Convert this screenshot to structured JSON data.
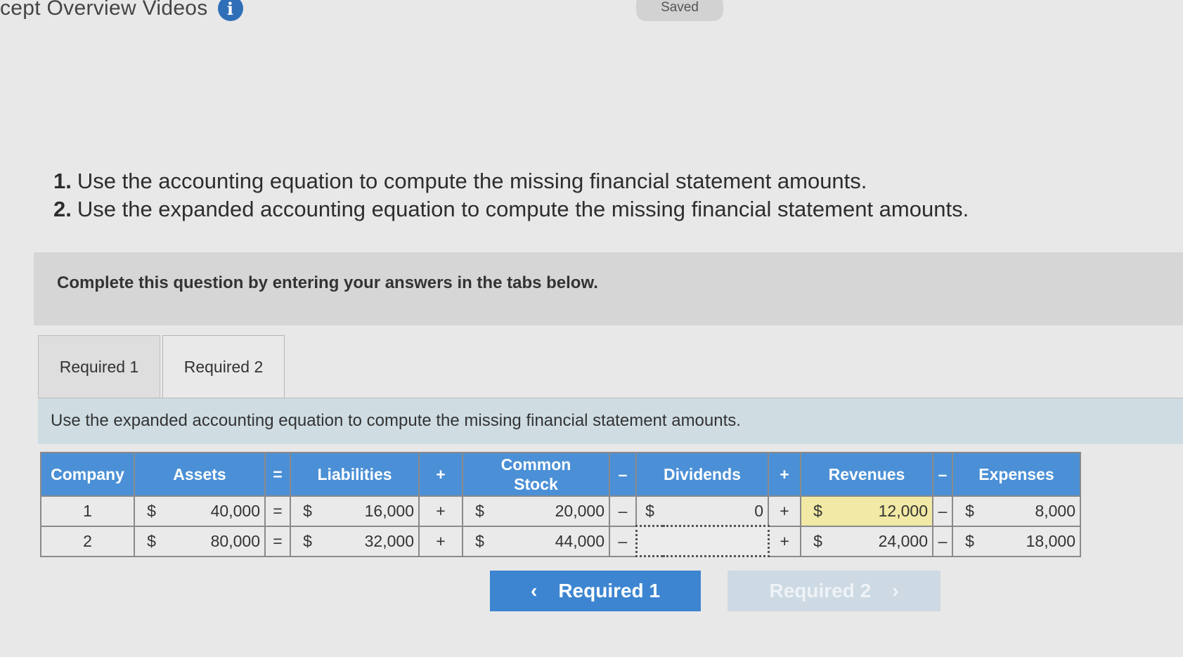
{
  "header": {
    "title": "cept Overview Videos",
    "info_icon": "i",
    "saved_label": "Saved"
  },
  "instructions": [
    {
      "num": "1.",
      "text": "Use the accounting equation to compute the missing financial statement amounts."
    },
    {
      "num": "2.",
      "text": "Use the expanded accounting equation to compute the missing financial statement amounts."
    }
  ],
  "banner": {
    "text": "Complete this question by entering your answers in the tabs below."
  },
  "tabs": [
    {
      "label": "Required 1"
    },
    {
      "label": "Required 2"
    }
  ],
  "sub_banner": {
    "text": "Use the expanded accounting equation to compute the missing financial statement amounts."
  },
  "table": {
    "headers": {
      "company": "Company",
      "assets": "Assets",
      "eq": "=",
      "liabilities": "Liabilities",
      "plus1": "+",
      "common_stock_line1": "Common",
      "common_stock_line2": "Stock",
      "minus1": "–",
      "dividends": "Dividends",
      "plus2": "+",
      "revenues": "Revenues",
      "minus2": "–",
      "expenses": "Expenses"
    },
    "rows": [
      {
        "company": "1",
        "assets_sign": "$",
        "assets": "40,000",
        "eq": "=",
        "liabilities_sign": "$",
        "liabilities": "16,000",
        "plus1": "+",
        "common_stock_sign": "$",
        "common_stock": "20,000",
        "minus1": "–",
        "dividends_sign": "$",
        "dividends": "0",
        "plus2": "+",
        "revenues_sign": "$",
        "revenues": "12,000",
        "minus2": "–",
        "expenses_sign": "$",
        "expenses": "8,000"
      },
      {
        "company": "2",
        "assets_sign": "$",
        "assets": "80,000",
        "eq": "=",
        "liabilities_sign": "$",
        "liabilities": "32,000",
        "plus1": "+",
        "common_stock_sign": "$",
        "common_stock": "44,000",
        "minus1": "–",
        "dividends_sign": "",
        "dividends": "",
        "plus2": "+",
        "revenues_sign": "$",
        "revenues": "24,000",
        "minus2": "–",
        "expenses_sign": "$",
        "expenses": "18,000"
      }
    ]
  },
  "nav": {
    "prev_label": "Required 1",
    "prev_icon": "‹",
    "next_label": "Required 2",
    "next_icon": "›"
  },
  "colors": {
    "header_blue": "#4b90d6",
    "button_blue": "#3d85d1",
    "highlight": "#f1e9a5"
  }
}
